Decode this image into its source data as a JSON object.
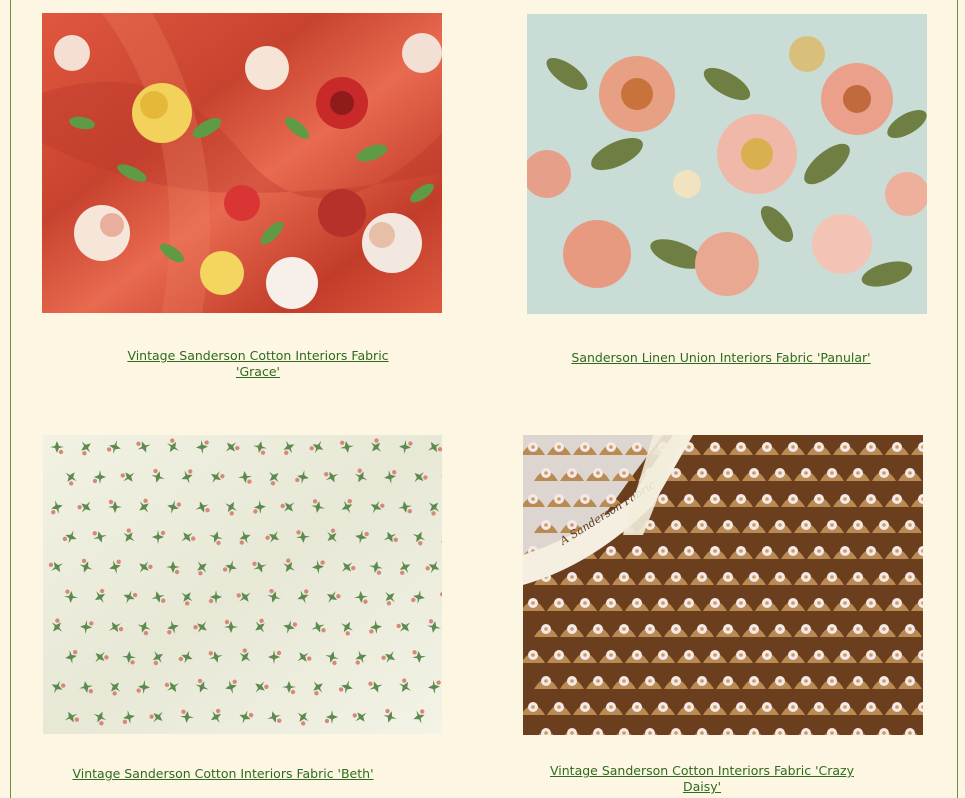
{
  "products": [
    {
      "title_line1": "Vintage Sanderson Cotton Interiors Fabric",
      "title_line2": "'Grace'",
      "image_alt": "coral red fabric with roses"
    },
    {
      "title_line1": "Sanderson Linen Union Interiors Fabric  'Panular'",
      "image_alt": "pale blue fabric with peach roses"
    },
    {
      "title_line1": "Vintage Sanderson Cotton Interiors Fabric 'Beth'",
      "image_alt": "cream fabric with small green leaf motif"
    },
    {
      "title_line1": "Vintage Sanderson Cotton Interiors Fabric 'Crazy Daisy'",
      "image_alt": "brown fabric with white daisy fans",
      "selvedge_text": "A Sanderson Fabric"
    }
  ]
}
